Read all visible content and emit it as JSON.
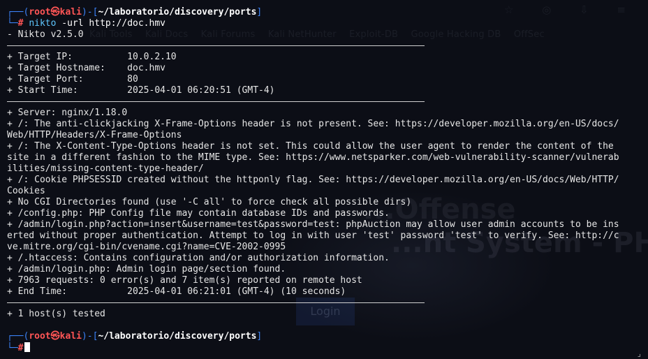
{
  "background": {
    "bookmarks": [
      "Kali Tools",
      "Kali Docs",
      "Kali Forums",
      "Kali NetHunter",
      "Exploit-DB",
      "Google Hacking DB",
      "OffSec"
    ],
    "page_title_line1": "...Offense",
    "page_title_line2": "...nt System - PHP",
    "login_button": "Login"
  },
  "prompt": {
    "box_top": "┌──(",
    "user": "root",
    "at": "㉿",
    "host": "kali",
    "mid": ")-[",
    "path": "~/laboratorio/discovery/ports",
    "end": "]",
    "box_bottom": "└─",
    "symbol": "#"
  },
  "command": {
    "name": "nikto",
    "args": " -url http://doc.hmv"
  },
  "output": {
    "version": "- Nikto v2.5.0",
    "target_ip": "+ Target IP:          10.0.2.10",
    "target_hostname": "+ Target Hostname:    doc.hmv",
    "target_port": "+ Target Port:        80",
    "start_time": "+ Start Time:         2025-04-01 06:20:51 (GMT-4)",
    "lines": [
      "+ Server: nginx/1.18.0",
      "+ /: The anti-clickjacking X-Frame-Options header is not present. See: https://developer.mozilla.org/en-US/docs/",
      "Web/HTTP/Headers/X-Frame-Options",
      "+ /: The X-Content-Type-Options header is not set. This could allow the user agent to render the content of the",
      "site in a different fashion to the MIME type. See: https://www.netsparker.com/web-vulnerability-scanner/vulnerab",
      "ilities/missing-content-type-header/",
      "+ /: Cookie PHPSESSID created without the httponly flag. See: https://developer.mozilla.org/en-US/docs/Web/HTTP/",
      "Cookies",
      "+ No CGI Directories found (use '-C all' to force check all possible dirs)",
      "+ /config.php: PHP Config file may contain database IDs and passwords.",
      "+ /admin/login.php?action=insert&username=test&password=test: phpAuction may allow user admin accounts to be ins",
      "erted without proper authentication. Attempt to log in with user 'test' password 'test' to verify. See: http://c",
      "ve.mitre.org/cgi-bin/cvename.cgi?name=CVE-2002-0995",
      "+ /.htaccess: Contains configuration and/or authorization information.",
      "+ /admin/login.php: Admin login page/section found.",
      "+ 7963 requests: 0 error(s) and 7 item(s) reported on remote host",
      "+ End Time:           2025-04-01 06:21:01 (GMT-4) (10 seconds)"
    ],
    "hosts_tested": "+ 1 host(s) tested"
  },
  "colors": {
    "background": "#0c0e16",
    "prompt_box": "#3b82f6",
    "prompt_user": "#ff5555",
    "command": "#5fc7ff",
    "text": "#e6e6e6"
  }
}
